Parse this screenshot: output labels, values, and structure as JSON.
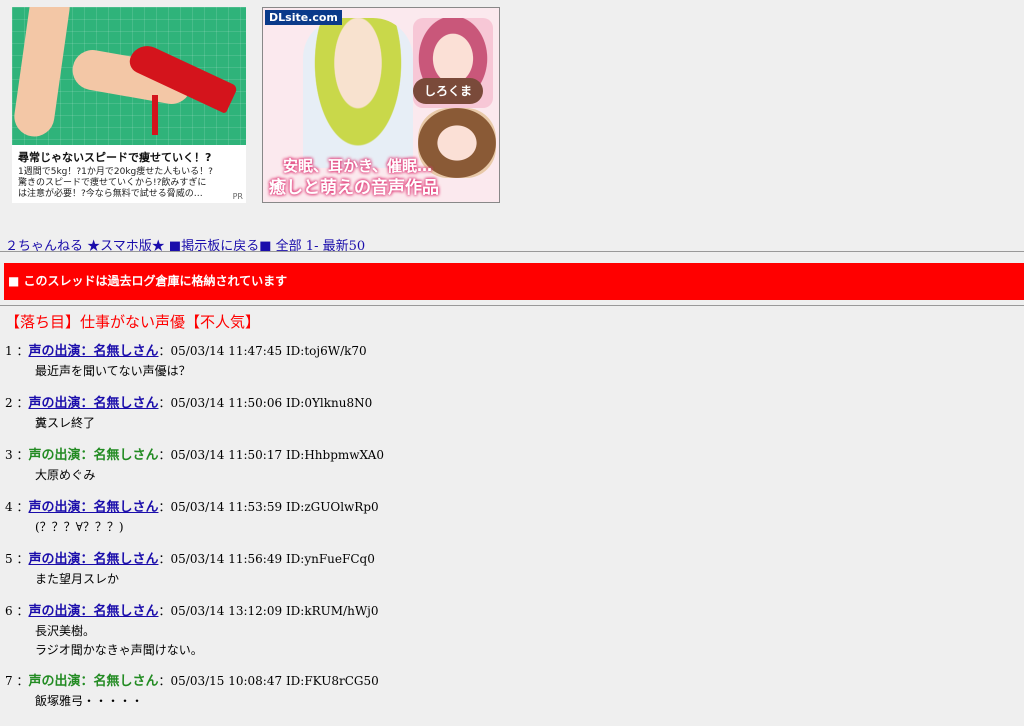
{
  "ads": {
    "left": {
      "headline": "尋常じゃないスピードで痩せていく！?",
      "body_lines": [
        "1週間で5kg！?1か月で20kg痩せた人もいる！?",
        "驚きのスピードで痩せていくから!?飲みすぎに",
        "は注意が必要！?今なら無料で試せる脅威の…"
      ],
      "pr": "PR"
    },
    "right": {
      "logo": "DLsite.com",
      "badge": "しろくま",
      "caption1": "安眠、耳かき、催眠…",
      "caption2": "癒しと萌えの音声作品"
    }
  },
  "nav": {
    "board_name": "２ちゃんねる",
    "smartphone": "★スマホ版★",
    "back": "■掲示板に戻る■",
    "all": "全部",
    "range": "1-",
    "latest": "最新50"
  },
  "banner": {
    "text": "■ このスレッドは過去ログ倉庫に格納されています"
  },
  "thread": {
    "title": "【落ち目】仕事がない声優【不人気】"
  },
  "posts": [
    {
      "num": "1",
      "name": "声の出演：名無しさん",
      "linked": true,
      "date": "05/03/14 11:47:45",
      "id": "ID:toj6W/k70",
      "lines": [
        "最近声を聞いてない声優は？"
      ]
    },
    {
      "num": "2",
      "name": "声の出演：名無しさん",
      "linked": true,
      "date": "05/03/14 11:50:06",
      "id": "ID:0Ylknu8N0",
      "lines": [
        "糞スレ終了"
      ]
    },
    {
      "num": "3",
      "name": "声の出演：名無しさん",
      "linked": false,
      "date": "05/03/14 11:50:17",
      "id": "ID:HhbpmwXA0",
      "lines": [
        "大原めぐみ"
      ]
    },
    {
      "num": "4",
      "name": "声の出演：名無しさん",
      "linked": true,
      "date": "05/03/14 11:53:59",
      "id": "ID:zGUOlwRp0",
      "lines": [
        "(？？？∀？？？)"
      ]
    },
    {
      "num": "5",
      "name": "声の出演：名無しさん",
      "linked": true,
      "date": "05/03/14 11:56:49",
      "id": "ID:ynFueFCq0",
      "lines": [
        "また望月スレか"
      ]
    },
    {
      "num": "6",
      "name": "声の出演：名無しさん",
      "linked": true,
      "date": "05/03/14 13:12:09",
      "id": "ID:kRUM/hWj0",
      "lines": [
        "長沢美樹。",
        "ラジオ聞かなきゃ声聞けない。"
      ]
    },
    {
      "num": "7",
      "name": "声の出演：名無しさん",
      "linked": false,
      "date": "05/03/15 10:08:47",
      "id": "ID:FKU8rCG50",
      "lines": [
        "飯塚雅弓・・・・・"
      ]
    }
  ]
}
